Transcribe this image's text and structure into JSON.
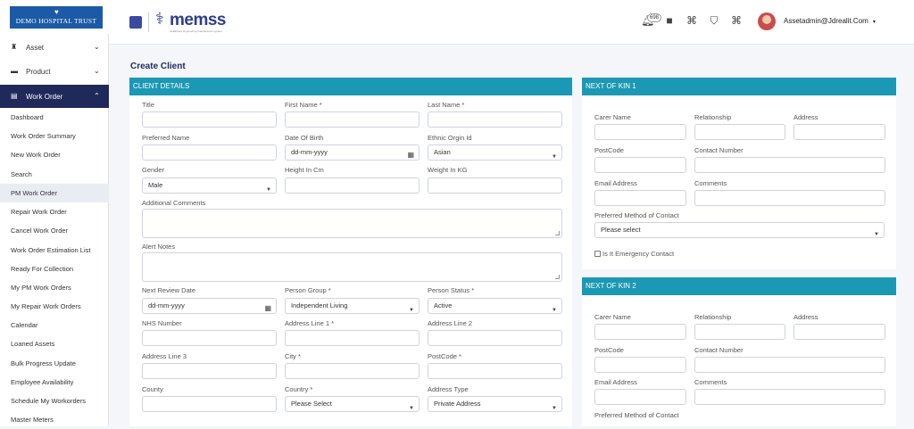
{
  "header": {
    "brand": "DEMO HOSPITAL TRUST",
    "logo_word": "memss",
    "logo_tag": "healthcare engineering maintenance system",
    "notification_count": "698",
    "user": "Assetadmin@Jdrealit.Com"
  },
  "sidebar": {
    "groups": [
      {
        "label": "Asset",
        "icon": "building-icon"
      },
      {
        "label": "Product",
        "icon": "box-icon"
      },
      {
        "label": "Work Order",
        "icon": "clipboard-icon"
      }
    ],
    "items": [
      {
        "label": "Dashboard"
      },
      {
        "label": "Work Order Summary"
      },
      {
        "label": "New Work Order"
      },
      {
        "label": "Search"
      },
      {
        "label": "PM Work Order"
      },
      {
        "label": "Repair Work Order"
      },
      {
        "label": "Cancel Work Order"
      },
      {
        "label": "Work Order Estimation List"
      },
      {
        "label": "Ready For Collection"
      },
      {
        "label": "My PM Work Orders"
      },
      {
        "label": "My Repair Work Orders"
      },
      {
        "label": "Calendar"
      },
      {
        "label": "Loaned Assets"
      },
      {
        "label": "Bulk Progress Update"
      },
      {
        "label": "Employee Availability"
      },
      {
        "label": "Schedule My Workorders"
      },
      {
        "label": "Master Meters"
      }
    ]
  },
  "page_title": "Create Client",
  "client_details": {
    "heading": "CLIENT DETAILS",
    "title_label": "Title",
    "first_name_label": "First Name *",
    "last_name_label": "Last Name *",
    "preferred_name_label": "Preferred Name",
    "dob_label": "Date Of Birth",
    "dob_placeholder": "dd-mm-yyyy",
    "ethnic_label": "Ethnic Orgin Id",
    "ethnic_value": "Asian",
    "gender_label": "Gender",
    "gender_value": "Male",
    "height_label": "Height In Cm",
    "weight_label": "Weight In KG",
    "comments_label": "Additional Comments",
    "alert_label": "Alert Notes",
    "review_label": "Next Review Date",
    "review_placeholder": "dd-mm-yyyy",
    "person_group_label": "Person Group *",
    "person_group_value": "Independent Living",
    "person_status_label": "Person Status *",
    "person_status_value": "Active",
    "nhs_label": "NHS Number",
    "addr1_label": "Address Line 1 *",
    "addr2_label": "Address Line 2",
    "addr3_label": "Address Line 3",
    "city_label": "City *",
    "postcode_label": "PostCode *",
    "county_label": "County",
    "country_label": "Country *",
    "country_value": "Please Select",
    "addr_type_label": "Address Type",
    "addr_type_value": "Private Address"
  },
  "nok1": {
    "heading": "NEXT OF KIN 1",
    "carer_label": "Carer Name",
    "relationship_label": "Relationship",
    "address_label": "Address",
    "postcode_label": "PostCode",
    "contact_label": "Contact Number",
    "email_label": "Email Address",
    "comments_label": "Comments",
    "method_label": "Preferred Method of Contact",
    "method_value": "Please select",
    "emergency_label": "Is It Emergency Contact"
  },
  "nok2": {
    "heading": "NEXT OF KIN 2",
    "carer_label": "Carer Name",
    "relationship_label": "Relationship",
    "address_label": "Address",
    "postcode_label": "PostCode",
    "contact_label": "Contact Number",
    "email_label": "Email Address",
    "comments_label": "Comments",
    "method_label": "Preferred Method of Contact"
  }
}
